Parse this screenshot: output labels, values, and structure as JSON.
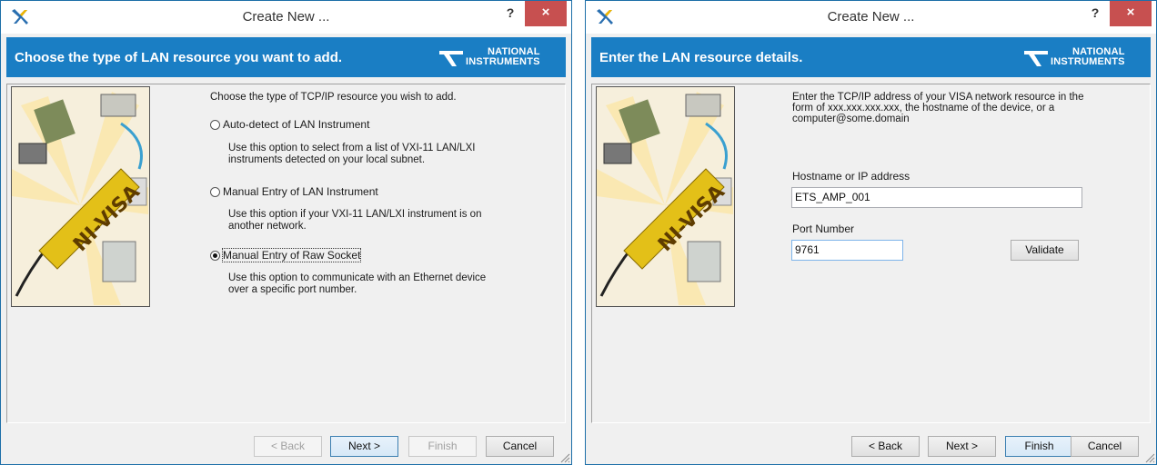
{
  "left": {
    "title": "Create New ...",
    "help": "?",
    "close": "×",
    "banner": "Choose the type of LAN resource you want to add.",
    "brand": {
      "line1": "NATIONAL",
      "line2": "INSTRUMENTS"
    },
    "picture_text": "NI-VISA",
    "intro": "Choose the type of TCP/IP resource you wish to add.",
    "options": [
      {
        "label": "Auto-detect of LAN Instrument",
        "selected": false,
        "desc1": "Use this option to select from a list of VXI-11 LAN/LXI",
        "desc2": "instruments detected on your local subnet."
      },
      {
        "label": "Manual Entry of LAN Instrument",
        "selected": false,
        "desc1": "Use this option if your VXI-11 LAN/LXI instrument is on",
        "desc2": "another network."
      },
      {
        "label": "Manual Entry of Raw Socket",
        "selected": true,
        "desc1": "Use this option to communicate with an Ethernet device",
        "desc2": "over a specific port number."
      }
    ],
    "buttons": {
      "back": "< Back",
      "next": "Next >",
      "finish": "Finish",
      "cancel": "Cancel"
    }
  },
  "right": {
    "title": "Create New ...",
    "help": "?",
    "close": "×",
    "banner": "Enter the LAN resource details.",
    "brand": {
      "line1": "NATIONAL",
      "line2": "INSTRUMENTS"
    },
    "picture_text": "NI-VISA",
    "intro1": "Enter the TCP/IP address of your VISA network resource in the",
    "intro2": "form of xxx.xxx.xxx.xxx, the hostname of the device, or a",
    "intro3": "computer@some.domain",
    "host_label": "Hostname or IP address",
    "host_value": "ETS_AMP_001",
    "port_label": "Port Number",
    "port_value": "9761",
    "validate": "Validate",
    "buttons": {
      "back": "< Back",
      "next": "Next >",
      "finish": "Finish",
      "cancel": "Cancel"
    }
  },
  "colors": {
    "banner": "#1a7ec4",
    "close": "#c75050",
    "window_border": "#1d6fa8"
  }
}
